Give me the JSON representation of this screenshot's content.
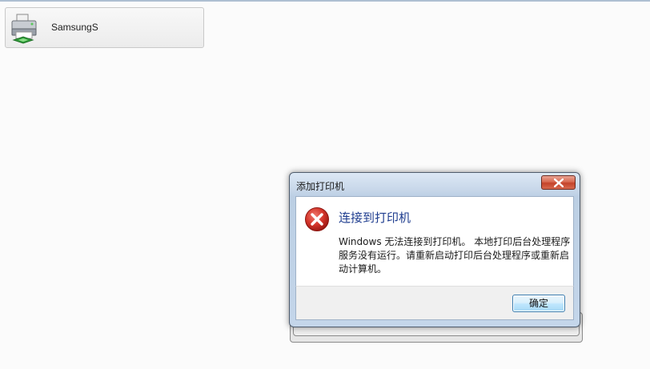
{
  "printer_tile": {
    "name": "SamsungS",
    "icon": "printer-icon"
  },
  "dialog": {
    "title": "添加打印机",
    "close_icon": "close-icon",
    "error_icon": "error-icon",
    "main_instruction": "连接到打印机",
    "message": "Windows 无法连接到打印机。  本地打印后台处理程序服务没有运行。请重新启动打印后台处理程序或重新启动计算机。",
    "ok_label": "确定"
  },
  "colors": {
    "instruction_blue": "#1f3d8f",
    "close_red": "#c4432a",
    "error_red": "#c8251b"
  }
}
